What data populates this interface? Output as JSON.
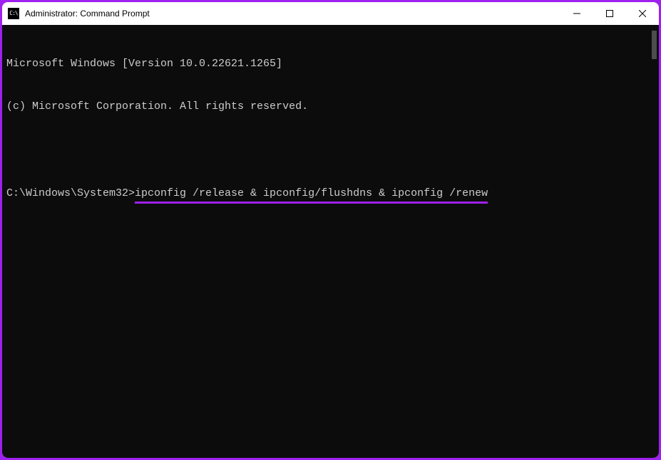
{
  "titlebar": {
    "icon_label": "C:\\",
    "title": "Administrator: Command Prompt"
  },
  "terminal": {
    "line1": "Microsoft Windows [Version 10.0.22621.1265]",
    "line2": "(c) Microsoft Corporation. All rights reserved.",
    "prompt_path": "C:\\Windows\\System32>",
    "command": "ipconfig /release & ipconfig/flushdns & ipconfig /renew"
  },
  "colors": {
    "highlight": "#a020f0",
    "terminal_bg": "#0c0c0c",
    "terminal_fg": "#cccccc"
  }
}
